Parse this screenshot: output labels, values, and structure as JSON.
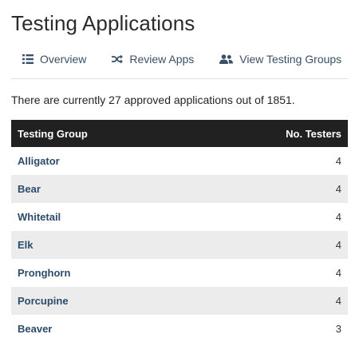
{
  "page": {
    "title": "Testing Applications"
  },
  "nav": {
    "overview": {
      "label": "Overview",
      "icon": "list-icon"
    },
    "review": {
      "label": "Review Apps",
      "icon": "shuffle-icon"
    },
    "groups": {
      "label": "View Testing Groups",
      "icon": "users-icon"
    }
  },
  "summary": "There are currently 27 approved applications out of 1851.",
  "table": {
    "headers": {
      "group": "Testing Group",
      "testers": "No. Testers"
    },
    "rows": [
      {
        "group": "Alligator",
        "testers": "4"
      },
      {
        "group": "Bear",
        "testers": "4"
      },
      {
        "group": "Whitetail",
        "testers": "4"
      },
      {
        "group": "Elk",
        "testers": "4"
      },
      {
        "group": "Pronghorn",
        "testers": "4"
      },
      {
        "group": "Porcupine",
        "testers": "4"
      },
      {
        "group": "Beaver",
        "testers": "3"
      }
    ]
  },
  "colors": {
    "link": "#2d4b6b",
    "header_bg": "#212121",
    "stripe": "#ececec"
  }
}
